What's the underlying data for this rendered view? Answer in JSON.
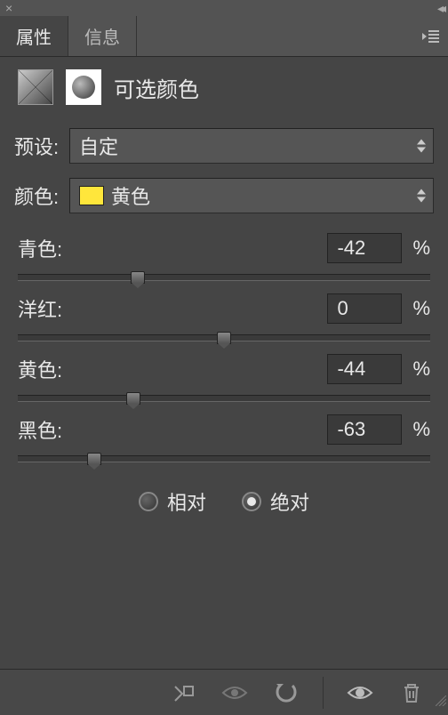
{
  "titlebar": {
    "close": "×",
    "collapse": "◂◂"
  },
  "tabs": {
    "properties": "属性",
    "info": "信息"
  },
  "adjustment": {
    "title": "可选颜色"
  },
  "preset": {
    "label": "预设:",
    "value": "自定"
  },
  "color": {
    "label": "颜色:",
    "value": "黄色",
    "swatch": "#ffe63b"
  },
  "sliders": {
    "cyan": {
      "label": "青色:",
      "value": "-42",
      "pct": "%"
    },
    "magenta": {
      "label": "洋红:",
      "value": "0",
      "pct": "%"
    },
    "yellow": {
      "label": "黄色:",
      "value": "-44",
      "pct": "%"
    },
    "black": {
      "label": "黑色:",
      "value": "-63",
      "pct": "%"
    }
  },
  "method": {
    "relative": "相对",
    "absolute": "绝对"
  }
}
